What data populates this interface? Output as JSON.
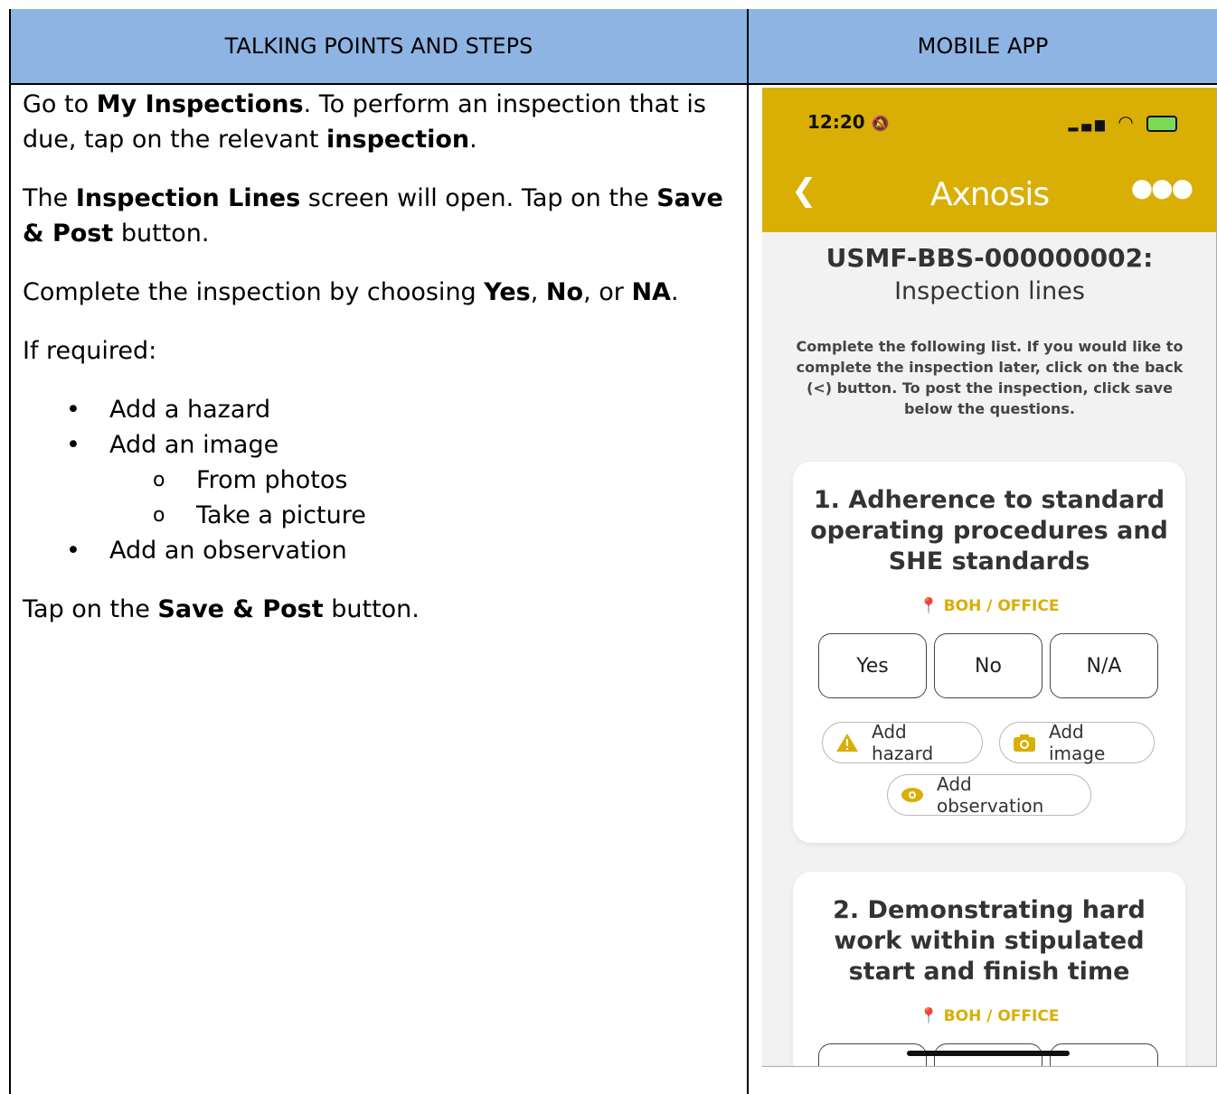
{
  "table": {
    "header_left": "TALKING POINTS AND STEPS",
    "header_right": "MOBILE APP"
  },
  "steps": {
    "p1_a": "Go to ",
    "p1_b": "My Inspections",
    "p1_c": ". To perform an inspection that is due, tap on the relevant ",
    "p1_d": "inspection",
    "p1_e": ".",
    "p2_a": "The ",
    "p2_b": "Inspection Lines",
    "p2_c": " screen will open. Tap on the ",
    "p2_d": "Save & Post",
    "p2_e": " button.",
    "p3_a": "Complete the inspection by choosing ",
    "p3_b": "Yes",
    "p3_c": ", ",
    "p3_d": "No",
    "p3_e": ", or ",
    "p3_f": "NA",
    "p3_g": ".",
    "p4": "If required:",
    "bullets": [
      "Add a hazard",
      "Add an image",
      "Add an observation"
    ],
    "sub_bullets": [
      "From photos",
      "Take a picture"
    ],
    "p5_a": "Tap on the ",
    "p5_b": "Save & Post",
    "p5_c": " button."
  },
  "phone": {
    "time": "12:20",
    "brand": "Axnosis",
    "title": "USMF-BBS-000000002:",
    "subtitle": "Inspection lines",
    "instructions": "Complete the following list. If you would like to complete the inspection later, click on the back (<) button. To post the inspection, click save below the questions.",
    "cards": [
      {
        "question": "1. Adherence to standard operating procedures and SHE standards",
        "location": "BOH / OFFICE",
        "answers": [
          "Yes",
          "No",
          "N/A"
        ],
        "actions": {
          "hazard": "Add hazard",
          "image": "Add image",
          "observation": "Add observation"
        }
      },
      {
        "question": "2. Demonstrating hard work within stipulated start and finish time",
        "location": "BOH / OFFICE"
      }
    ],
    "colors": {
      "brand": "#d9ae05",
      "header_blue": "#8eb4e3"
    }
  }
}
